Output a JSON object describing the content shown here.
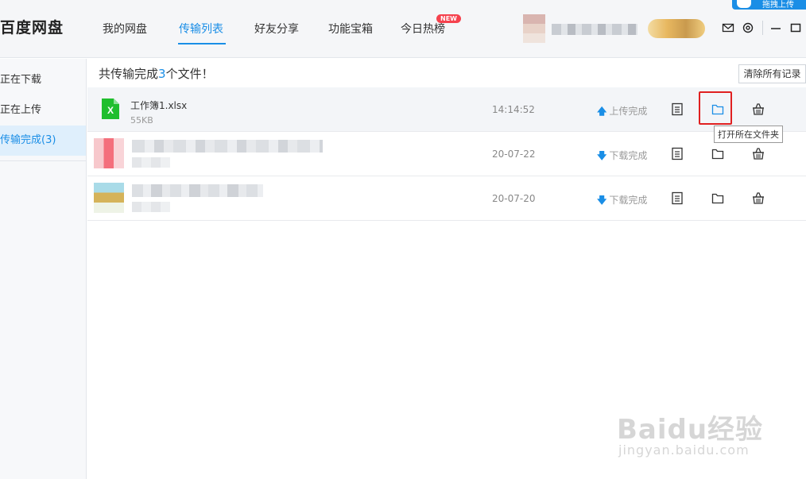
{
  "corner_button": {
    "label": "拖拽上传"
  },
  "header": {
    "logo": "百度网盘",
    "nav": [
      {
        "label": "我的网盘",
        "active": false
      },
      {
        "label": "传输列表",
        "active": true
      },
      {
        "label": "好友分享",
        "active": false
      },
      {
        "label": "功能宝箱",
        "active": false
      },
      {
        "label": "今日热榜",
        "active": false
      }
    ],
    "new_badge": "NEW",
    "icons": [
      "mail-icon",
      "settings-icon",
      "minimize-icon",
      "maximize-icon"
    ]
  },
  "sidebar": {
    "items": [
      {
        "label": "正在下载",
        "active": false
      },
      {
        "label": "正在上传",
        "active": false
      },
      {
        "label": "传输完成(3)",
        "active": true
      }
    ]
  },
  "main": {
    "summary_prefix": "共传输完成",
    "summary_count": "3",
    "summary_suffix": "个文件！",
    "clear_button": "清除所有记录",
    "rows": [
      {
        "name": "工作簿1.xlsx",
        "size": "55KB",
        "time": "14:14:52",
        "status": "上传完成",
        "direction": "up",
        "icon": "excel-file-icon"
      },
      {
        "name": "",
        "size": "",
        "time": "20-07-22",
        "status": "下载完成",
        "direction": "down",
        "icon": "image-thumbnail"
      },
      {
        "name": "",
        "size": "",
        "time": "20-07-20",
        "status": "下载完成",
        "direction": "down",
        "icon": "image-thumbnail"
      }
    ],
    "tooltip": "打开所在文件夹"
  },
  "watermark": {
    "main": "Baidu经验",
    "sub": "jingyan.baidu.com"
  },
  "colors": {
    "accent": "#1a8ee6",
    "highlight": "#e02020",
    "excel": "#1fbe2e"
  }
}
